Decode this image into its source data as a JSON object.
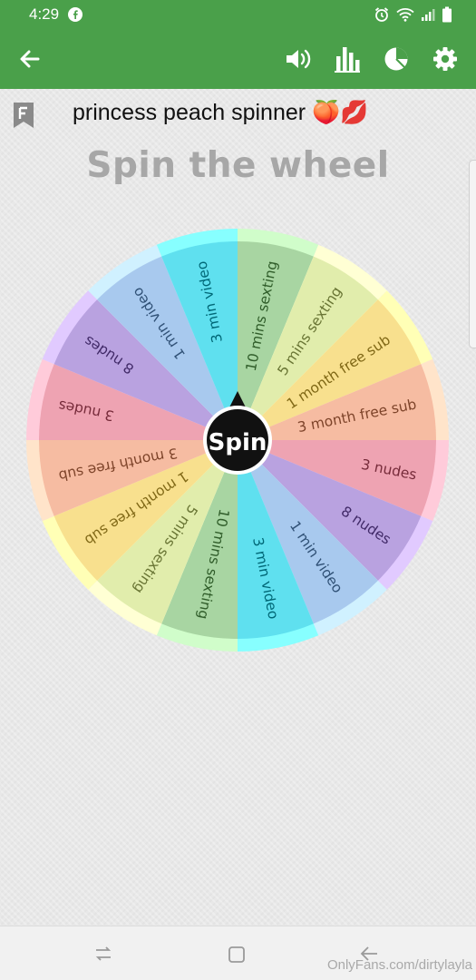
{
  "status_bar": {
    "time": "4:29"
  },
  "app_bar": {
    "icons": [
      "back-arrow-icon",
      "volume-icon",
      "bar-chart-icon",
      "pie-chart-icon",
      "gear-icon"
    ]
  },
  "wheel": {
    "title": "princess peach spinner 🍑💋",
    "heading": "Spin the wheel",
    "spin_label": "Spin",
    "segments": [
      {
        "label": "10 mins sexting",
        "color": "#a8d5a2"
      },
      {
        "label": "5 mins sexting",
        "color": "#e1edac"
      },
      {
        "label": "1 month free sub",
        "color": "#f8e08e"
      },
      {
        "label": "3 month free sub",
        "color": "#f6bca2"
      },
      {
        "label": "3 nudes",
        "color": "#eea3b2"
      },
      {
        "label": "8 nudes",
        "color": "#b9a2e0"
      },
      {
        "label": "1 min video",
        "color": "#a8c9ee"
      },
      {
        "label": "3 min video",
        "color": "#5fe0ef"
      },
      {
        "label": "10 mins sexting",
        "color": "#a8d5a2"
      },
      {
        "label": "5 mins sexting",
        "color": "#e1edac"
      },
      {
        "label": "1 month free sub",
        "color": "#f8e08e"
      },
      {
        "label": "3 month free sub",
        "color": "#f6bca2"
      },
      {
        "label": "3 nudes",
        "color": "#eea3b2"
      },
      {
        "label": "8 nudes",
        "color": "#b9a2e0"
      },
      {
        "label": "1 min video",
        "color": "#a8c9ee"
      },
      {
        "label": "3 min video",
        "color": "#5fe0ef"
      }
    ]
  },
  "nav_bar": {
    "icons": [
      "recent-apps-icon",
      "home-icon",
      "back-icon"
    ]
  },
  "watermark": "OnlyFans.com/dirtylayla"
}
